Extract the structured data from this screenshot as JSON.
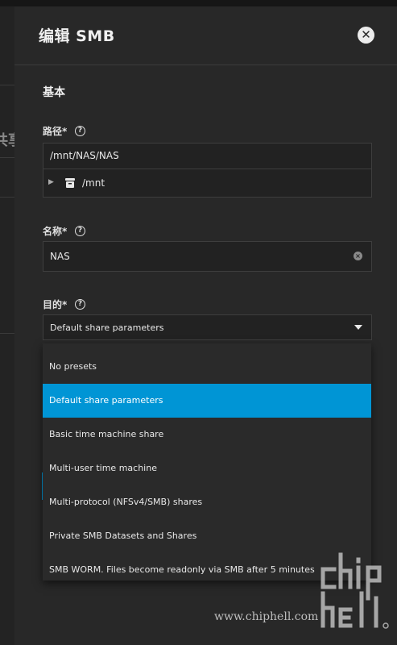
{
  "background": {
    "fragment_text": "共享"
  },
  "dialog": {
    "title": "编辑 SMB",
    "close_icon": "close-icon"
  },
  "section": {
    "title": "基本"
  },
  "path": {
    "label": "路径*",
    "help": "?",
    "value": "/mnt/NAS/NAS",
    "tree_item": "/mnt"
  },
  "name": {
    "label": "名称*",
    "help": "?",
    "value": "NAS",
    "clear": "×"
  },
  "purpose": {
    "label": "目的*",
    "help": "?",
    "selected": "Default share parameters",
    "options": [
      "No presets",
      "Default share parameters",
      "Basic time machine share",
      "Multi-user time machine",
      "Multi-protocol (NFSv4/SMB) shares",
      "Private SMB Datasets and Shares",
      "SMB WORM. Files become readonly via SMB after 5 minutes"
    ]
  },
  "watermark": {
    "url": "www.chiphell.com"
  },
  "colors": {
    "accent": "#0095d5",
    "panel": "#282828",
    "background": "#1e1e1e"
  }
}
